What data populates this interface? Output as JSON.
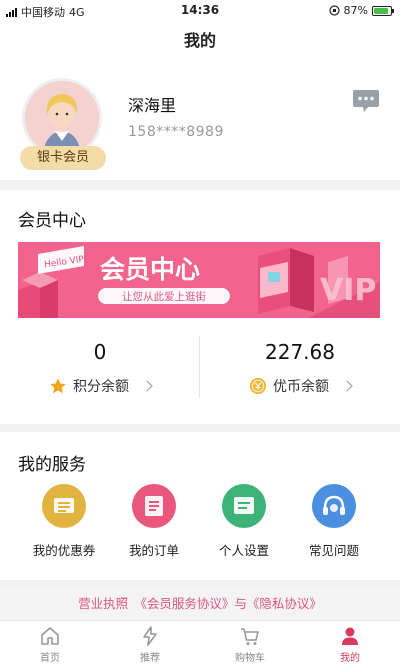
{
  "status_bar": {
    "carrier": "中国移动",
    "network": "4G",
    "time": "14:36",
    "battery": "87%"
  },
  "header": {
    "title": "我的"
  },
  "profile": {
    "username": "深海里",
    "phone": "158****8989",
    "member_badge": "银卡会员"
  },
  "member_center": {
    "title": "会员中心",
    "banner": {
      "tag": "Hello VIP!",
      "headline": "会员中心",
      "slogan": "让您从此爱上逛街",
      "brand_letters": "VIP"
    },
    "points": {
      "value": "0",
      "label": "积分余额"
    },
    "coins": {
      "value": "227.68",
      "label": "优币余额"
    }
  },
  "services": {
    "title": "我的服务",
    "items": [
      {
        "label": "我的优惠券",
        "icon": "coupon-icon",
        "color": "#e0b43f"
      },
      {
        "label": "我的订单",
        "icon": "order-icon",
        "color": "#e9577c"
      },
      {
        "label": "个人设置",
        "icon": "settings-icon",
        "color": "#3db37a"
      },
      {
        "label": "常见问题",
        "icon": "help-headset-icon",
        "color": "#4a8fe0"
      }
    ]
  },
  "footer": {
    "links_text": "营业执照　《会员服务协议》与《隐私协议》"
  },
  "tabbar": {
    "items": [
      {
        "label": "首页",
        "icon": "home-icon"
      },
      {
        "label": "推荐",
        "icon": "lightning-icon"
      },
      {
        "label": "购物车",
        "icon": "cart-icon"
      },
      {
        "label": "我的",
        "icon": "person-icon",
        "active": true
      }
    ]
  },
  "colors": {
    "accent": "#d8395f",
    "banner_pink": "#f2638d"
  }
}
